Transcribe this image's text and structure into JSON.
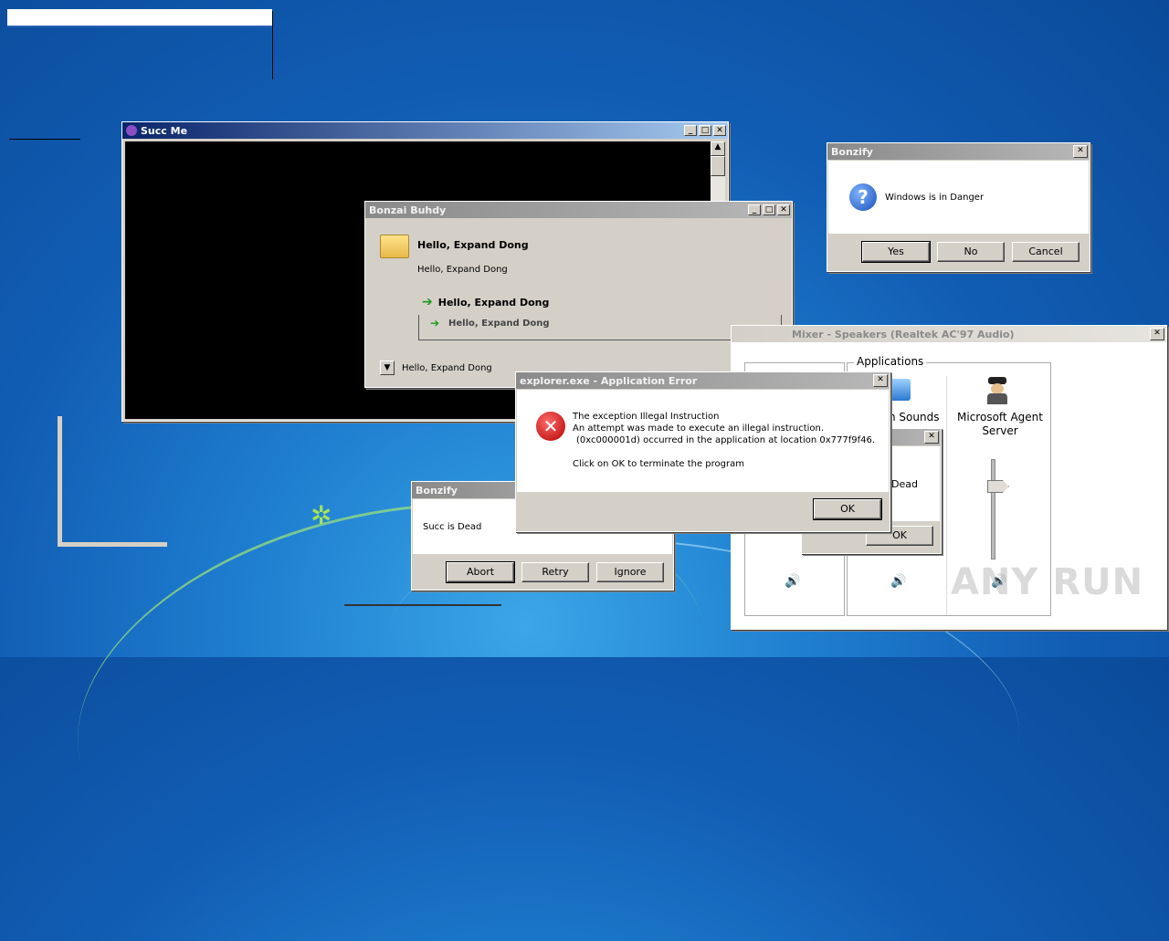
{
  "succ_window": {
    "title": "Succ Me"
  },
  "buhdy_window": {
    "title": "Bonzai Buhdy",
    "heading": "Hello, Expand Dong",
    "subtext": "Hello, Expand Dong",
    "link1": "Hello, Expand Dong",
    "link2": "Hello, Expand Dong",
    "expand_label": "Hello, Expand Dong"
  },
  "bonzify_danger": {
    "title": "Bonzify",
    "message": "Windows is in Danger",
    "yes": "Yes",
    "no": "No",
    "cancel": "Cancel"
  },
  "mixer": {
    "title": "Mixer - Speakers (Realtek AC'97 Audio)",
    "group_label": "Applications",
    "app1": "n Sounds",
    "app2": "Microsoft Agent Server",
    "inner_dialog_text": "Dead",
    "inner_ok": "OK"
  },
  "app_error": {
    "title": "explorer.exe - Application Error",
    "line1": "The exception Illegal Instruction",
    "line2": "An attempt was made to execute an illegal instruction.",
    "line3": "(0xc000001d) occurred in the application at location 0x777f9f46.",
    "line4": "Click on OK to terminate the program",
    "ok": "OK"
  },
  "bonzify_dead": {
    "title": "Bonzify",
    "message": "Succ is Dead",
    "abort": "Abort",
    "retry": "Retry",
    "ignore": "Ignore"
  },
  "watermark": "ANY RUN"
}
